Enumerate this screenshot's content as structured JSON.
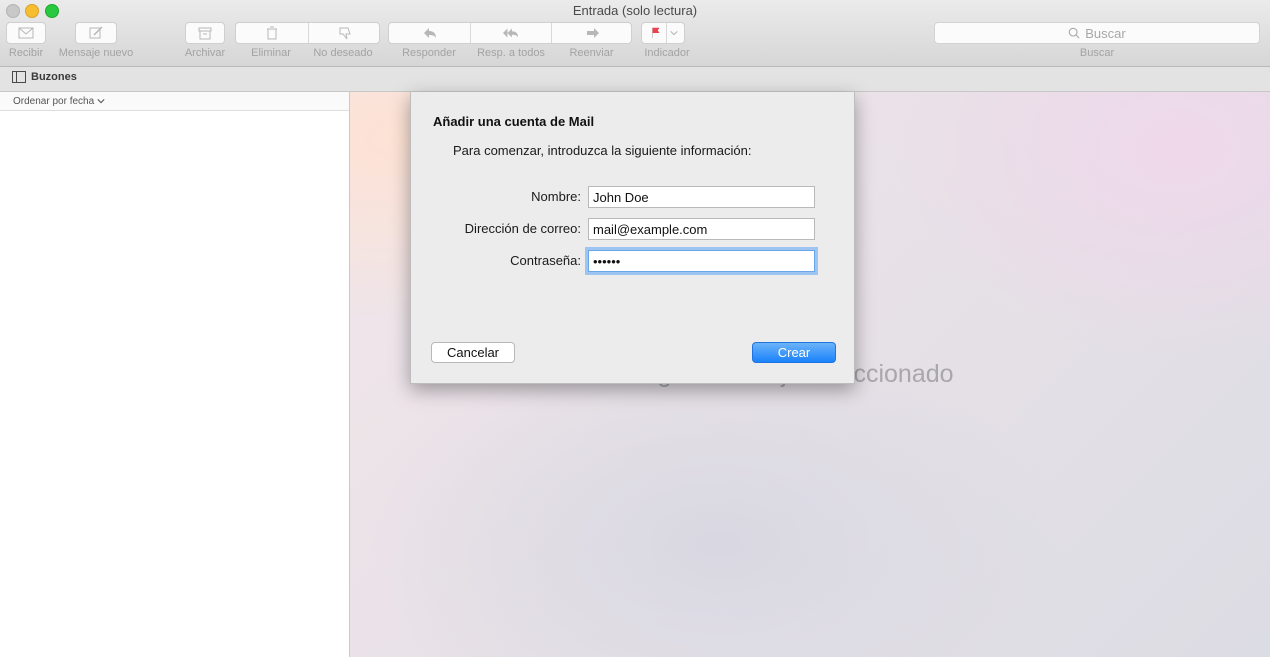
{
  "window": {
    "title": "Entrada (solo lectura)"
  },
  "toolbar": {
    "receive": "Recibir",
    "new_message": "Mensaje nuevo",
    "archive": "Archivar",
    "delete": "Eliminar",
    "junk": "No deseado",
    "reply": "Responder",
    "reply_all": "Resp. a todos",
    "forward": "Reenviar",
    "flag": "Indicador",
    "search_placeholder": "Buscar",
    "search_label": "Buscar"
  },
  "mailboxes_label": "Buzones",
  "sort_label": "Ordenar por fecha",
  "no_message": "Ningún mensaje seleccionado",
  "dialog": {
    "title": "Añadir una cuenta de Mail",
    "subtitle": "Para comenzar, introduzca la siguiente información:",
    "name_label": "Nombre:",
    "name_value": "John Doe",
    "email_label": "Dirección de correo:",
    "email_value": "mail@example.com",
    "password_label": "Contraseña:",
    "password_value": "••••••",
    "cancel": "Cancelar",
    "create": "Crear"
  },
  "colors": {
    "accent": "#1a82fb",
    "flag": "#e8434f"
  }
}
